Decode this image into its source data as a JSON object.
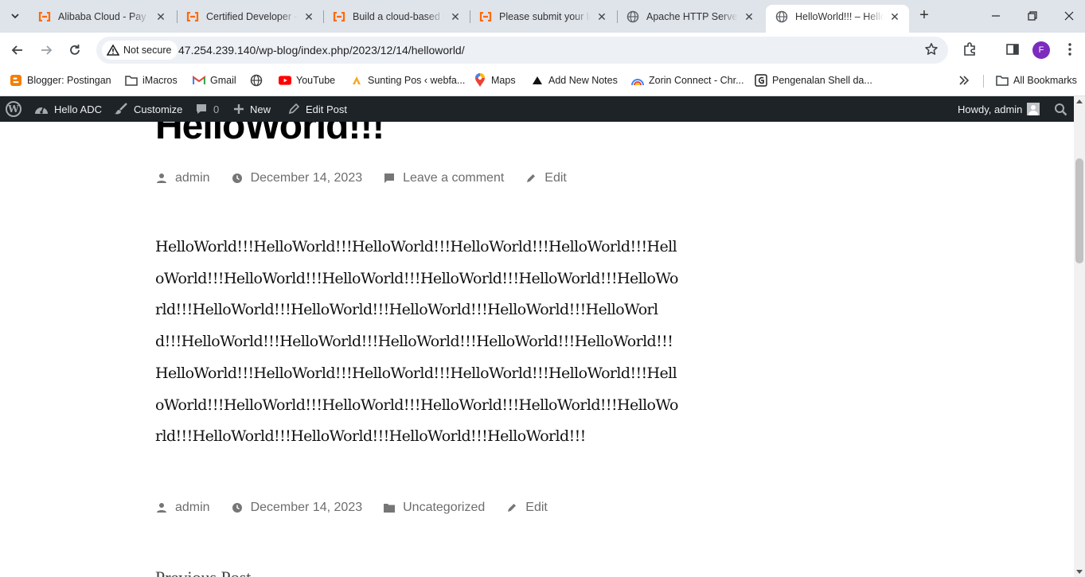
{
  "browser": {
    "tabs": [
      {
        "title": "Alibaba Cloud - Pay S",
        "favicon": "alibaba-icon"
      },
      {
        "title": "Certified Developer -",
        "favicon": "alibaba-icon"
      },
      {
        "title": "Build a cloud-based b",
        "favicon": "alibaba-icon"
      },
      {
        "title": "Please submit your la",
        "favicon": "alibaba-icon"
      },
      {
        "title": "Apache HTTP Server",
        "favicon": "globe-icon"
      },
      {
        "title": "HelloWorld!!! – Hello",
        "favicon": "globe-icon",
        "active": true
      }
    ],
    "url": "47.254.239.140/wp-blog/index.php/2023/12/14/helloworld/",
    "security_label": "Not secure",
    "profile_initial": "F",
    "accent_color": "#7b2bbd"
  },
  "bookmarks": {
    "items": [
      {
        "label": "Blogger: Postingan",
        "icon": "blogger-icon"
      },
      {
        "label": "iMacros",
        "icon": "folder-icon"
      },
      {
        "label": "Gmail",
        "icon": "gmail-icon"
      },
      {
        "label": "",
        "icon": "globe-icon"
      },
      {
        "label": "YouTube",
        "icon": "youtube-icon"
      },
      {
        "label": "Sunting Pos ‹ webfa...",
        "icon": "wordpress-icon"
      },
      {
        "label": "Maps",
        "icon": "maps-icon"
      },
      {
        "label": "Add New Notes",
        "icon": "notes-icon"
      },
      {
        "label": "Zorin Connect - Chr...",
        "icon": "zorin-icon"
      },
      {
        "label": "Pengenalan Shell da...",
        "icon": "shell-icon"
      }
    ],
    "all_bookmarks": "All Bookmarks"
  },
  "adminbar": {
    "site_name": "Hello ADC",
    "customize": "Customize",
    "comments_count": "0",
    "new_label": "New",
    "edit_post": "Edit Post",
    "howdy": "Howdy, admin"
  },
  "post": {
    "title": "HelloWorld!!!",
    "author": "admin",
    "date": "December 14, 2023",
    "comment_link": "Leave a comment",
    "edit_link": "Edit",
    "body": "HelloWorld!!!HelloWorld!!!HelloWorld!!!HelloWorld!!!HelloWorld!!!HelloWorld!!!HelloWorld!!!HelloWorld!!!HelloWorld!!!HelloWorld!!!HelloWorld!!!HelloWorld!!!HelloWorld!!!HelloWorld!!!HelloWorld!!!HelloWorld!!!HelloWorld!!!HelloWorld!!!HelloWorld!!!HelloWorld!!!HelloWorld!!!HelloWorld!!!HelloWorld!!!HelloWorld!!!HelloWorld!!!HelloWorld!!!HelloWorld!!!HelloWorld!!!HelloWorld!!!HelloWorld!!!HelloWorld!!!HelloWorld!!!HelloWorld!!!HelloWorld!!!HelloWorld!!!HelloWorld!!!",
    "footer_author": "admin",
    "footer_date": "December 14, 2023",
    "footer_category": "Uncategorized",
    "footer_edit": "Edit",
    "partial_heading": "Previous Post"
  }
}
